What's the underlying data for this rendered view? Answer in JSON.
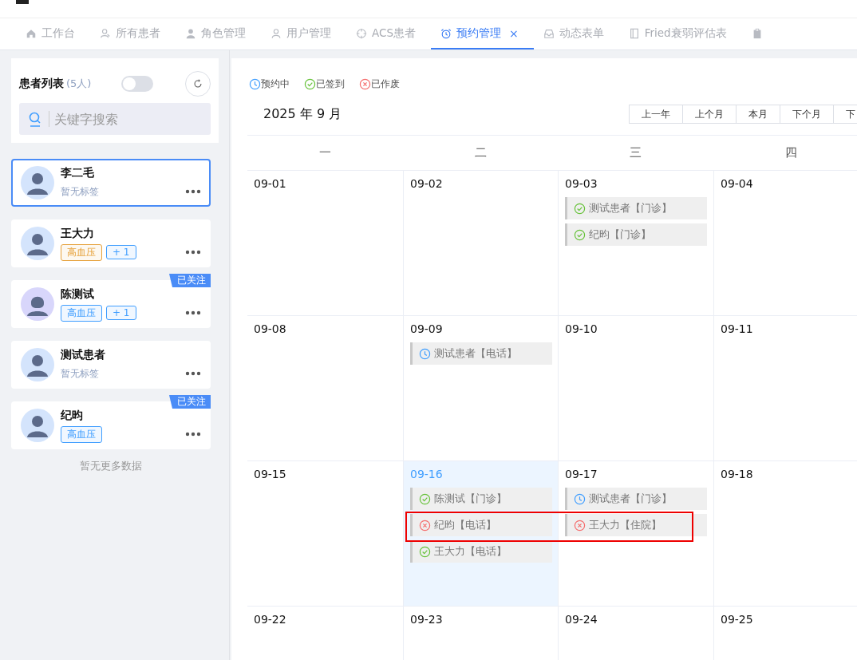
{
  "tabs": [
    {
      "label": "工作台",
      "kind": "home",
      "selected": false
    },
    {
      "label": "所有患者",
      "kind": "users",
      "selected": false
    },
    {
      "label": "角色管理",
      "kind": "usersolid",
      "selected": false
    },
    {
      "label": "用户管理",
      "kind": "user",
      "selected": false
    },
    {
      "label": "ACS患者",
      "kind": "crosshair",
      "selected": false
    },
    {
      "label": "预约管理",
      "kind": "alarm",
      "selected": true,
      "close": "×"
    },
    {
      "label": "动态表单",
      "kind": "tray",
      "selected": false
    },
    {
      "label": "Fried衰弱评估表",
      "kind": "doc",
      "selected": false
    },
    {
      "kind": "clipboard",
      "selected": false
    }
  ],
  "sidebar": {
    "title": "患者列表",
    "count": "(5人)",
    "toggle": {
      "on": false
    },
    "search": {
      "placeholder": "关键字搜索"
    },
    "patients": [
      {
        "name": "李二毛",
        "kind": "male",
        "selected": true,
        "empty_tags": "暂无标签"
      },
      {
        "name": "王大力",
        "kind": "male",
        "selected": false,
        "tags": [
          {
            "text": "高血压",
            "color": "#e6a23c"
          },
          {
            "text": "+ 1",
            "color": "#409eff"
          }
        ]
      },
      {
        "name": "陈测试",
        "kind": "female",
        "selected": false,
        "badge": "已关注",
        "tags": [
          {
            "text": "高血压",
            "color": "#409eff"
          },
          {
            "text": "+ 1",
            "color": "#409eff"
          }
        ]
      },
      {
        "name": "测试患者",
        "kind": "male",
        "selected": false,
        "empty_tags": "暂无标签"
      },
      {
        "name": "纪昀",
        "kind": "male",
        "selected": false,
        "badge": "已关注",
        "tags": [
          {
            "text": "高血压",
            "color": "#409eff"
          }
        ]
      }
    ],
    "footer": "暂无更多数据"
  },
  "calendar": {
    "legend": [
      {
        "kind": "pending",
        "label": "预约中"
      },
      {
        "kind": "done",
        "label": "已签到"
      },
      {
        "kind": "void",
        "label": "已作废"
      }
    ],
    "title": "2025 年 9 月",
    "buttons": [
      "上一年",
      "上个月",
      "本月",
      "下个月",
      "下"
    ],
    "weekdays": [
      "一",
      "二",
      "三",
      "四"
    ],
    "weeks": [
      {
        "days": [
          {
            "date": "09-01",
            "today": false
          },
          {
            "date": "09-02",
            "today": false
          },
          {
            "date": "09-03",
            "today": false,
            "events": [
              {
                "kind": "done",
                "text": "测试患者【门诊】"
              },
              {
                "kind": "done",
                "text": "纪昀【门诊】"
              }
            ]
          },
          {
            "date": "09-04",
            "today": false
          }
        ]
      },
      {
        "days": [
          {
            "date": "09-08",
            "today": false
          },
          {
            "date": "09-09",
            "today": false,
            "events": [
              {
                "kind": "pending",
                "text": "测试患者【电话】"
              }
            ]
          },
          {
            "date": "09-10",
            "today": false
          },
          {
            "date": "09-11",
            "today": false
          }
        ]
      },
      {
        "highlight": true,
        "days": [
          {
            "date": "09-15",
            "today": false
          },
          {
            "date": "09-16",
            "today": true,
            "events": [
              {
                "kind": "done",
                "text": "陈测试【门诊】"
              },
              {
                "kind": "void",
                "text": "纪昀【电话】"
              },
              {
                "kind": "done",
                "text": "王大力【电话】"
              }
            ]
          },
          {
            "date": "09-17",
            "today": false,
            "events": [
              {
                "kind": "pending",
                "text": "测试患者【门诊】"
              },
              {
                "kind": "void",
                "text": "王大力【住院】"
              }
            ]
          },
          {
            "date": "09-18",
            "today": false
          }
        ]
      },
      {
        "days": [
          {
            "date": "09-22",
            "today": false
          },
          {
            "date": "09-23",
            "today": false
          },
          {
            "date": "09-24",
            "today": false
          },
          {
            "date": "09-25",
            "today": false
          }
        ]
      }
    ]
  }
}
